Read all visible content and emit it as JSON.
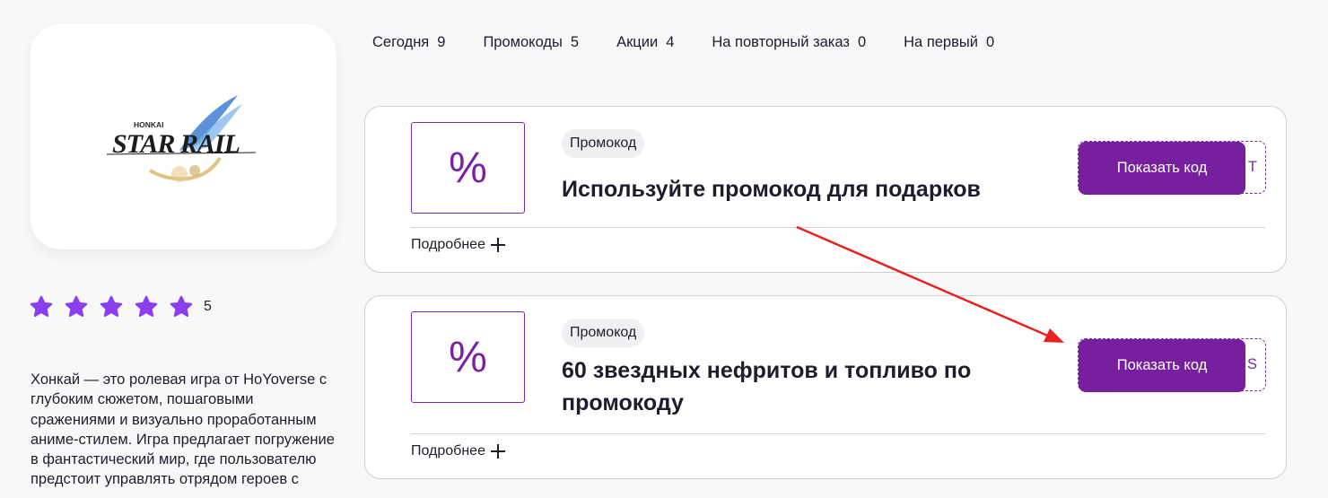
{
  "logo": {
    "icon": "honkai-star-rail-logo",
    "top_text": "HONKAI",
    "main_text": "STAR RAIL"
  },
  "rating": {
    "stars": 5,
    "max_stars": 5,
    "value": "5",
    "star_color": "#8b3df0"
  },
  "description": "Хонкай — это ролевая игра от HoYoverse с глубоким сюжетом, пошаговыми сражениями и визуально проработанным аниме-стилем. Игра предлагает погружение в фантастический мир, где пользователю предстоит управлять отрядом героев с",
  "tabs": [
    {
      "label": "Сегодня",
      "count": "9"
    },
    {
      "label": "Промокоды",
      "count": "5"
    },
    {
      "label": "Акции",
      "count": "4"
    },
    {
      "label": "На повторный заказ",
      "count": "0"
    },
    {
      "label": "На первый",
      "count": "0"
    }
  ],
  "offers": [
    {
      "icon": "percent-icon",
      "icon_text": "%",
      "tag": "Промокод",
      "title": "Используйте промокод для подарков",
      "button_label": "Показать код",
      "code_peek": "T",
      "more_label": "Подробнее"
    },
    {
      "icon": "percent-icon",
      "icon_text": "%",
      "tag": "Промокод",
      "title": "60 звездных нефритов и топливо по промокоду",
      "button_label": "Показать код",
      "code_peek": "S",
      "more_label": "Подробнее"
    }
  ],
  "colors": {
    "accent": "#76209f",
    "annotation_arrow": "#e8201e"
  }
}
